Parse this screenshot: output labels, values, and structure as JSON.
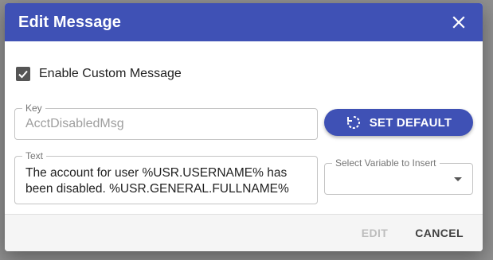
{
  "dialog": {
    "title": "Edit Message",
    "enable_custom_message": {
      "label": "Enable Custom Message",
      "checked": true
    },
    "key_field": {
      "legend": "Key",
      "value": "AcctDisabledMsg"
    },
    "set_default_label": "SET DEFAULT",
    "text_field": {
      "legend": "Text",
      "value": "The account for user %USR.USERNAME% has been disabled. %USR.GENERAL.FULLNAME%"
    },
    "variable_select": {
      "legend": "Select Variable to Insert",
      "value": ""
    },
    "footer": {
      "edit_label": "EDIT",
      "cancel_label": "CANCEL"
    }
  },
  "colors": {
    "primary": "#3f51b5",
    "overlay": "#8f8f8f"
  },
  "icons": {
    "close": "close-icon",
    "check": "check-icon",
    "reset": "reset-icon",
    "dropdown": "chevron-down-icon"
  }
}
